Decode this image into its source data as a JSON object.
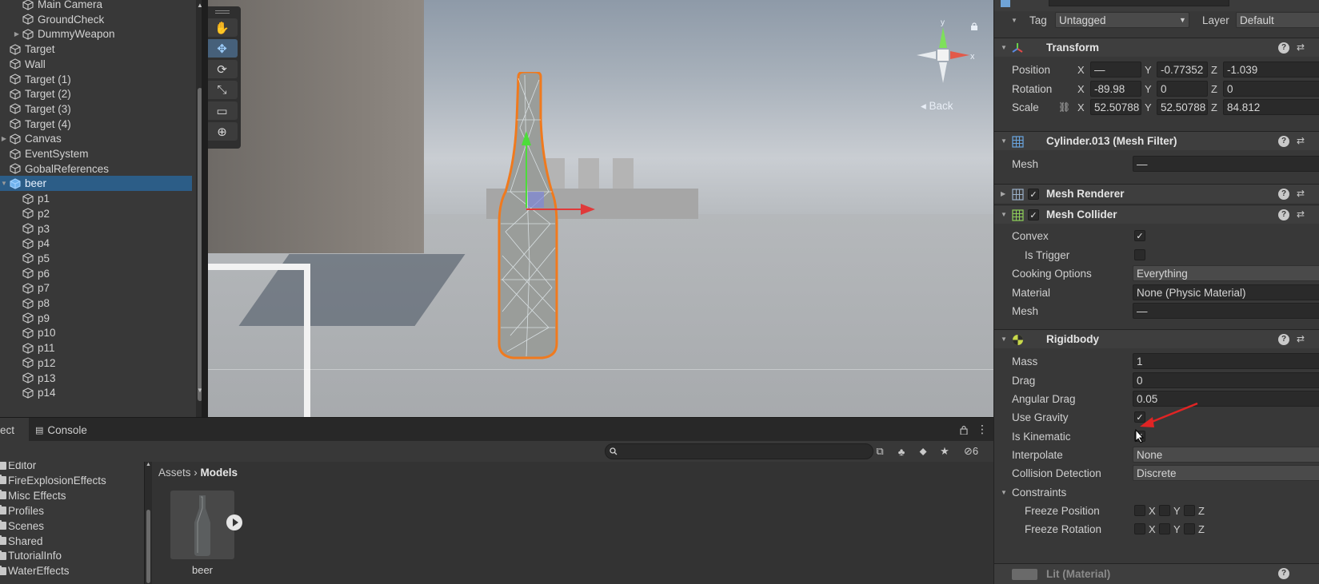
{
  "hierarchy": {
    "items": [
      {
        "label": "Main Camera",
        "indent": 2
      },
      {
        "label": "GroundCheck",
        "indent": 2
      },
      {
        "label": "DummyWeapon",
        "indent": 2,
        "folded": true
      },
      {
        "label": "Target",
        "indent": 1
      },
      {
        "label": "Wall",
        "indent": 1
      },
      {
        "label": "Target (1)",
        "indent": 1
      },
      {
        "label": "Target (2)",
        "indent": 1
      },
      {
        "label": "Target (3)",
        "indent": 1
      },
      {
        "label": "Target (4)",
        "indent": 1
      },
      {
        "label": "Canvas",
        "indent": 1,
        "folded": true
      },
      {
        "label": "EventSystem",
        "indent": 1
      },
      {
        "label": "GobalReferences",
        "indent": 1
      },
      {
        "label": "beer",
        "indent": 1,
        "expanded": true,
        "selected": true
      },
      {
        "label": "p1",
        "indent": 2
      },
      {
        "label": "p2",
        "indent": 2
      },
      {
        "label": "p3",
        "indent": 2
      },
      {
        "label": "p4",
        "indent": 2
      },
      {
        "label": "p5",
        "indent": 2
      },
      {
        "label": "p6",
        "indent": 2
      },
      {
        "label": "p7",
        "indent": 2
      },
      {
        "label": "p8",
        "indent": 2
      },
      {
        "label": "p9",
        "indent": 2
      },
      {
        "label": "p10",
        "indent": 2
      },
      {
        "label": "p11",
        "indent": 2
      },
      {
        "label": "p12",
        "indent": 2
      },
      {
        "label": "p13",
        "indent": 2
      },
      {
        "label": "p14",
        "indent": 2
      }
    ]
  },
  "scene": {
    "back_label": "Back",
    "gizmo_y": "y",
    "gizmo_x": "x"
  },
  "bottom_tabs": {
    "project_label": "ect",
    "console_label": "Console"
  },
  "project": {
    "hidden_count": "6",
    "folders": [
      "Editor",
      "FireExplosionEffects",
      "Misc Effects",
      "Profiles",
      "Scenes",
      "Shared",
      "TutorialInfo",
      "WaterEffects"
    ],
    "breadcrumb_root": "Assets",
    "breadcrumb_sep": "›",
    "breadcrumb_current": "Models",
    "asset_name": "beer"
  },
  "inspector": {
    "tag_label": "Tag",
    "tag_value": "Untagged",
    "layer_label": "Layer",
    "layer_value": "Default",
    "transform": {
      "title": "Transform",
      "position_label": "Position",
      "rotation_label": "Rotation",
      "scale_label": "Scale",
      "position": {
        "x": "—",
        "y": "-0.77352",
        "z": "-1.039"
      },
      "rotation": {
        "x": "-89.98",
        "y": "0",
        "z": "0"
      },
      "scale": {
        "x": "52.50788",
        "y": "52.50788",
        "z": "84.812"
      }
    },
    "mesh_filter": {
      "title": "Cylinder.013 (Mesh Filter)",
      "mesh_label": "Mesh",
      "mesh_value": "—"
    },
    "mesh_renderer": {
      "title": "Mesh Renderer"
    },
    "mesh_collider": {
      "title": "Mesh Collider",
      "convex_label": "Convex",
      "trigger_label": "Is Trigger",
      "cooking_label": "Cooking Options",
      "cooking_value": "Everything",
      "material_label": "Material",
      "material_value": "None (Physic Material)",
      "mesh_label": "Mesh",
      "mesh_value": "—"
    },
    "rigidbody": {
      "title": "Rigidbody",
      "mass_label": "Mass",
      "mass": "1",
      "drag_label": "Drag",
      "drag": "0",
      "angular_drag_label": "Angular Drag",
      "angular_drag": "0.05",
      "gravity_label": "Use Gravity",
      "kinematic_label": "Is Kinematic",
      "interpolate_label": "Interpolate",
      "interpolate": "None",
      "collision_label": "Collision Detection",
      "collision": "Discrete",
      "constraints_label": "Constraints",
      "freeze_pos_label": "Freeze Position",
      "freeze_rot_label": "Freeze Rotation",
      "axis_x": "X",
      "axis_y": "Y",
      "axis_z": "Z"
    },
    "material": {
      "title": "Lit (Material)"
    },
    "checkmark": "✓",
    "help_glyph": "?"
  },
  "colors": {
    "selection": "#2c5d87",
    "annotation_arrow": "#e02424",
    "bottle_outline": "#f07a1e"
  }
}
